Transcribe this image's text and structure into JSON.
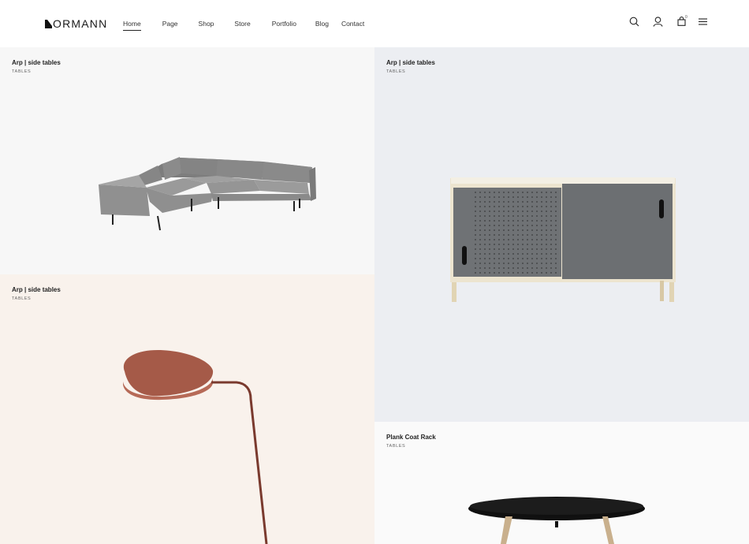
{
  "header": {
    "logo_text": "ORMANN",
    "nav": [
      {
        "label": "Home",
        "active": true
      },
      {
        "label": "Page",
        "active": false
      },
      {
        "label": "Shop",
        "active": false
      },
      {
        "label": "Store",
        "active": false
      },
      {
        "label": "Portfolio",
        "active": false
      },
      {
        "label": "Blog",
        "active": false
      },
      {
        "label": "Contact",
        "active": false
      }
    ],
    "icons": [
      "search-icon",
      "user-icon",
      "cart-icon",
      "menu-icon"
    ],
    "cart_count": "0"
  },
  "products": [
    {
      "title": "Arp | side tables",
      "category": "TABLES",
      "image": "sofa-image",
      "bg": "#f7f7f7"
    },
    {
      "title": "Arp | side tables",
      "category": "TABLES",
      "image": "sideboard-image",
      "bg": "#eceef2"
    },
    {
      "title": "Arp | side tables",
      "category": "TABLES",
      "image": "floor-lamp-image",
      "bg": "#f9f2ec"
    },
    {
      "title": "Plank Coat Rack",
      "category": "TABLES",
      "image": "round-table-image",
      "bg": "#fafafa"
    }
  ]
}
